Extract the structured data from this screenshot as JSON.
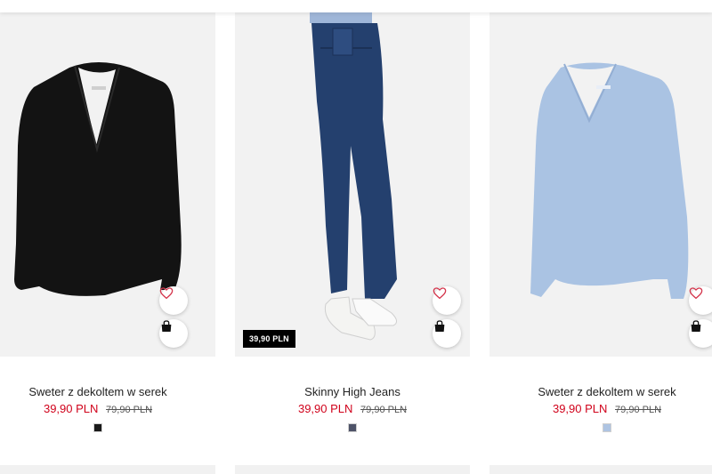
{
  "products": [
    {
      "title": "Sweter z dekoltem w serek",
      "price": "39,90 PLN",
      "old_price": "79,90 PLN",
      "swatch_color": "#1a1a1a",
      "garment_color": "#111111"
    },
    {
      "title": "Skinny High Jeans",
      "price": "39,90 PLN",
      "old_price": "79,90 PLN",
      "badge": "39,90 PLN",
      "swatch_color": "#4e5368",
      "garment_color": "#24406e"
    },
    {
      "title": "Sweter z dekoltem w serek",
      "price": "39,90 PLN",
      "old_price": "79,90 PLN",
      "swatch_color": "#aec4e2",
      "garment_color": "#aac3e3"
    }
  ],
  "colors": {
    "sale_price": "#d0021b",
    "heart_icon": "#d4364d"
  },
  "icons": {
    "favorite": "heart-icon",
    "add_to_bag": "shopping-bag-icon"
  }
}
